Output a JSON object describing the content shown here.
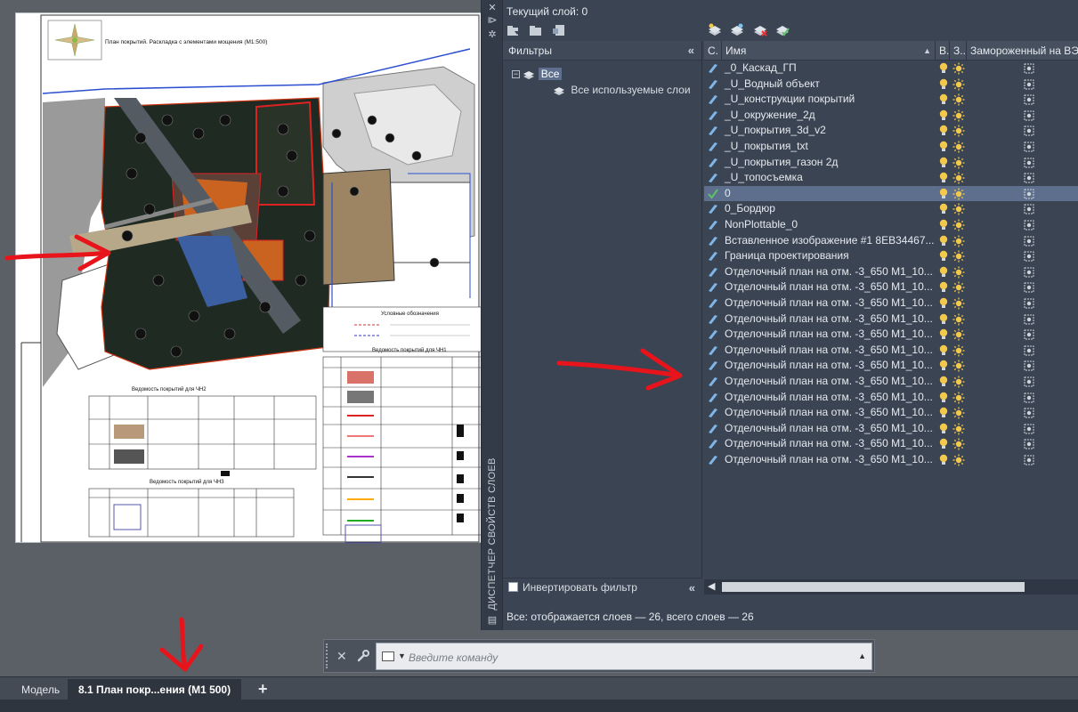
{
  "palette": {
    "current_layer": "Текущий слой: 0",
    "vertical_title": "ДИСПЕТЧЕР СВОЙСТВ СЛОЕВ",
    "filters": {
      "header": "Фильтры",
      "root": "Все",
      "child": "Все используемые слои",
      "invert_label": "Инвертировать фильтр"
    },
    "columns": {
      "status": "С.",
      "name": "Имя",
      "on": "В..",
      "freeze": "З..",
      "vp_freeze": "Замороженный на ВЭ"
    },
    "layers": [
      {
        "name": "_0_Каскад_ГП",
        "current": false
      },
      {
        "name": "_U_Водный объект",
        "current": false
      },
      {
        "name": "_U_конструкции покрытий",
        "current": false
      },
      {
        "name": "_U_окружение_2д",
        "current": false
      },
      {
        "name": "_U_покрытия_3d_v2",
        "current": false
      },
      {
        "name": "_U_покрытия_txt",
        "current": false
      },
      {
        "name": "_U_покрытия_газон 2д",
        "current": false
      },
      {
        "name": "_U_топосъемка",
        "current": false
      },
      {
        "name": "0",
        "current": true
      },
      {
        "name": "0_Бордюр",
        "current": false
      },
      {
        "name": "NonPlottable_0",
        "current": false
      },
      {
        "name": "Вставленное изображение #1 8EB34467...",
        "current": false
      },
      {
        "name": "Граница проектирования",
        "current": false
      },
      {
        "name": "Отделочный план на отм. -3_650 М1_10...",
        "current": false
      },
      {
        "name": "Отделочный план на отм. -3_650 М1_10...",
        "current": false
      },
      {
        "name": "Отделочный план на отм. -3_650 М1_10...",
        "current": false
      },
      {
        "name": "Отделочный план на отм. -3_650 М1_10...",
        "current": false
      },
      {
        "name": "Отделочный план на отм. -3_650 М1_10...",
        "current": false
      },
      {
        "name": "Отделочный план на отм. -3_650 М1_10...",
        "current": false
      },
      {
        "name": "Отделочный план на отм. -3_650 М1_10...",
        "current": false
      },
      {
        "name": "Отделочный план на отм. -3_650 М1_10...",
        "current": false
      },
      {
        "name": "Отделочный план на отм. -3_650 М1_10...",
        "current": false
      },
      {
        "name": "Отделочный план на отм. -3_650 М1_10...",
        "current": false
      },
      {
        "name": "Отделочный план на отм. -3_650 М1_10...",
        "current": false
      },
      {
        "name": "Отделочный план на отм. -3_650 М1_10...",
        "current": false
      },
      {
        "name": "Отделочный план на отм. -3_650 М1_10...",
        "current": false
      }
    ],
    "status": "Все: отображается слоев — 26, всего слоев — 26"
  },
  "drawing": {
    "sheet_title": "План покрытий. Раскладка с элементами мощения (М1:500)",
    "legend_title": "Условные обозначения",
    "table1_title": "Ведомость покрытий для ЧН1",
    "table2_title": "Ведомость покрытий для ЧН2",
    "table3_title": "Ведомость покрытий для ЧН3"
  },
  "command": {
    "placeholder": "Введите команду"
  },
  "tabs": {
    "model": "Модель",
    "layout": "8.1 План покр...ения (М1 500)",
    "add": "+"
  },
  "colors": {
    "palette_bg": "#3b4453",
    "selection": "#5d6f8c",
    "bulb": "#f2c94c",
    "annotation_red": "#e8141b"
  }
}
